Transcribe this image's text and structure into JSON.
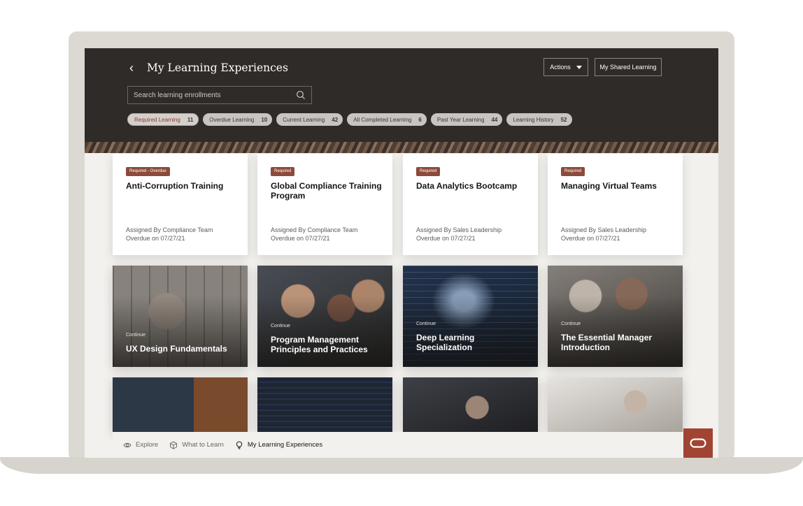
{
  "header": {
    "title": "My Learning Experiences",
    "actions_label": "Actions",
    "shared_label": "My Shared Learning"
  },
  "search": {
    "placeholder": "Search learning enrollments"
  },
  "filters": [
    {
      "label": "Required Learning",
      "count": "11"
    },
    {
      "label": "Overdue Learning",
      "count": "10"
    },
    {
      "label": "Current Learning",
      "count": "42"
    },
    {
      "label": "All Completed Learning",
      "count": "6"
    },
    {
      "label": "Past Year Learning",
      "count": "44"
    },
    {
      "label": "Learning History",
      "count": "52"
    }
  ],
  "required_cards": [
    {
      "badge": "Required - Overdue",
      "title": "Anti-Corruption Training",
      "assigned": "Assigned By Compliance Team",
      "due": "Overdue on 07/27/21"
    },
    {
      "badge": "Required",
      "title": "Global Compliance Training Program",
      "assigned": "Assigned By Compliance Team",
      "due": "Overdue on 07/27/21"
    },
    {
      "badge": "Required",
      "title": "Data Analytics Bootcamp",
      "assigned": "Assigned By Sales Leadership",
      "due": "Overdue on 07/27/21"
    },
    {
      "badge": "Required",
      "title": "Managing Virtual Teams",
      "assigned": "Assigned By Sales Leadership",
      "due": "Overdue on 07/27/21"
    }
  ],
  "course_tiles": [
    {
      "status": "Continue",
      "title": "UX Design Fundamentals"
    },
    {
      "status": "Continue",
      "title": "Program Management Principles and Practices"
    },
    {
      "status": "Continue",
      "title": "Deep Learning Specialization"
    },
    {
      "status": "Continue",
      "title": "The Essential Manager Introduction"
    }
  ],
  "bottom_nav": [
    {
      "label": "Explore",
      "icon": "eye-icon"
    },
    {
      "label": "What to Learn",
      "icon": "cube-icon"
    },
    {
      "label": "My Learning Experiences",
      "icon": "lightbulb-icon"
    }
  ],
  "colors": {
    "header_bg": "#2f2b28",
    "badge": "#8d4a3a",
    "accent": "#a14433"
  }
}
